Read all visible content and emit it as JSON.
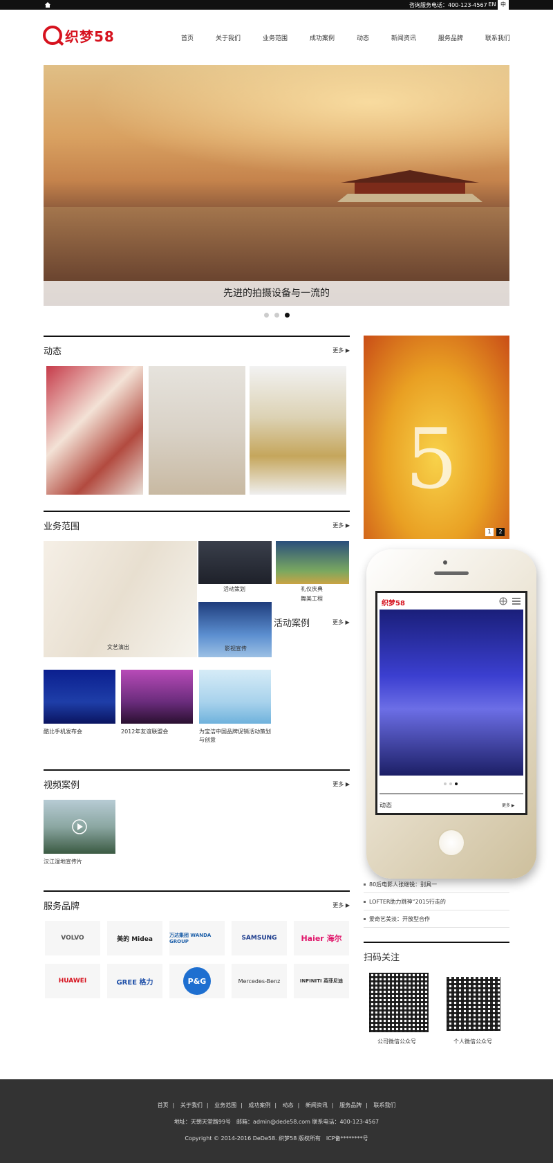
{
  "topbar": {
    "hotline": "咨询服务电话：400-123-4567",
    "en": "EN",
    "zh": "中"
  },
  "logo": {
    "text": "织梦58"
  },
  "nav": [
    "首页",
    "关于我们",
    "业务范围",
    "成功案例",
    "动态",
    "新闻资讯",
    "服务品牌",
    "联系我们"
  ],
  "banner": {
    "caption": "先进的拍摄设备与一流的"
  },
  "news": {
    "title": "动态",
    "more": "更多 ▶"
  },
  "business": {
    "title": "业务范围",
    "more": "更多 ▶",
    "items": [
      "文艺演出",
      "活动策划",
      "礼仪庆典",
      "影视宣传",
      "舞美工程"
    ]
  },
  "cases": {
    "title": "活动案例",
    "more": "更多 ▶",
    "items": [
      "酷比手机发布会",
      "2012年友谊联盟会",
      "为宝洁中国品牌促销活动策划与创意"
    ]
  },
  "video": {
    "title": "视频案例",
    "more": "更多 ▶",
    "items": [
      "汉江湿地宣传片"
    ]
  },
  "brands": {
    "title": "服务品牌",
    "more": "更多 ▶",
    "items": [
      "VOLVO",
      "美的 Midea",
      "万达集团 WANDA GROUP",
      "SAMSUNG",
      "Haier 海尔",
      "HUAWEI",
      "GREE 格力",
      "P&G",
      "Mercedes-Benz",
      "INFINITI 英菲尼迪"
    ]
  },
  "side": {
    "pager": [
      "1",
      "2"
    ],
    "news": [
      "80后电影人张继锐：别具一",
      "LOFTER助力跳神“2015行走的",
      "爱奇艺美淡：开放型合作"
    ],
    "scan_title": "扫码关注",
    "qr": [
      "公司微信公众号",
      "个人微信公众号"
    ]
  },
  "phone": {
    "logo": "织梦58",
    "news_title": "动态",
    "more": "更多 ▶"
  },
  "footer": {
    "links": [
      "首页",
      "关于我们",
      "业务范围",
      "成功案例",
      "动态",
      "新闻资讯",
      "服务品牌",
      "联系我们"
    ],
    "address": "地址：天朝天堂路99号　邮箱：admin@dede58.com 联系电话：400-123-4567",
    "copyright": "Copyright © 2014-2016 DeDe58. 织梦58 版权所有　ICP备********号"
  },
  "colors": {
    "brand": "#d6121e",
    "dark": "#111111",
    "footer": "#333333"
  }
}
